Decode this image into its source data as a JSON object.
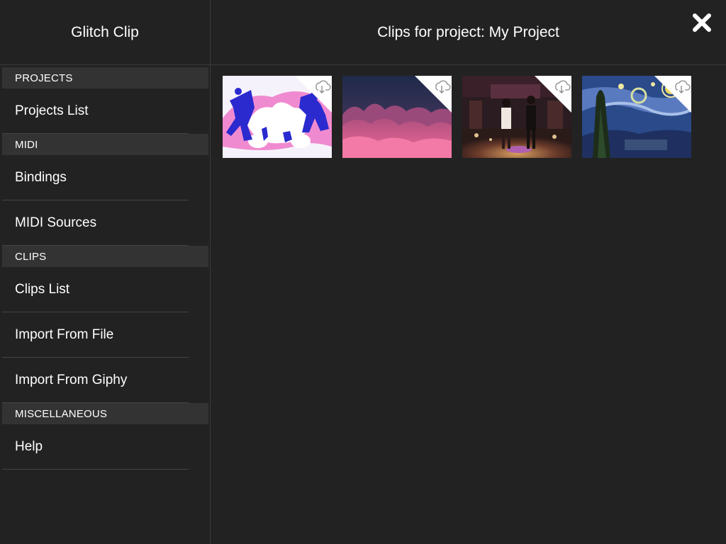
{
  "sidebar": {
    "title": "Glitch Clip",
    "sections": [
      {
        "header": "PROJECTS",
        "items": [
          "Projects List"
        ]
      },
      {
        "header": "MIDI",
        "items": [
          "Bindings",
          "MIDI Sources"
        ]
      },
      {
        "header": "CLIPS",
        "items": [
          "Clips List",
          "Import From File",
          "Import From Giphy"
        ]
      },
      {
        "header": "MISCELLANEOUS",
        "items": [
          "Help"
        ]
      }
    ]
  },
  "main": {
    "title": "Clips for project: My Project",
    "close_icon": "close-icon",
    "clips": [
      {
        "thumb": "dancers-illustration",
        "badge_icon": "cloud-download-icon"
      },
      {
        "thumb": "pink-waves",
        "badge_icon": "cloud-download-icon"
      },
      {
        "thumb": "dance-scene",
        "badge_icon": "cloud-download-icon"
      },
      {
        "thumb": "starry-night",
        "badge_icon": "cloud-download-icon"
      }
    ]
  },
  "colors": {
    "background": "#222222",
    "section_header_bg": "#333333",
    "divider": "#444444",
    "text": "#ffffff"
  }
}
